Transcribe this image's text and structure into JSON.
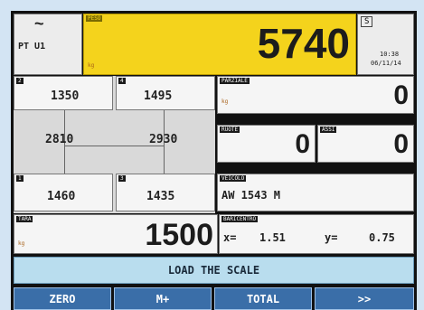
{
  "colors": {
    "accent_yellow": "#f4d31c",
    "banner_blue": "#b9ddee",
    "button_blue": "#3a6ea8"
  },
  "header": {
    "wave_icon": "~",
    "pt_label": "PT U1",
    "main_tag": "PESO",
    "main_value": "5740",
    "main_unit": "kg",
    "s_label": "S",
    "time": "10:38",
    "date": "06/11/14"
  },
  "axles": [
    {
      "index": "2",
      "value": "1350"
    },
    {
      "index": "4",
      "value": "1495"
    },
    {
      "value": "2810"
    },
    {
      "value": "2930"
    },
    {
      "index": "1",
      "value": "1460"
    },
    {
      "index": "3",
      "value": "1435"
    }
  ],
  "partial": {
    "tag": "PARZIALE",
    "unit": "kg",
    "value": "0"
  },
  "wheels": {
    "tag": "RUOTE",
    "value": "0"
  },
  "axles_count": {
    "tag": "ASSI",
    "value": "0"
  },
  "vehicle": {
    "tag": "VEICOLO",
    "value": "AW 1543 M"
  },
  "tare": {
    "tag": "TARA",
    "unit": "kg",
    "value": "1500"
  },
  "gravity": {
    "tag": "BARICENTRO",
    "x_label": "x=",
    "x_value": "1.51",
    "y_label": "y=",
    "y_value": "0.75"
  },
  "banner": "LOAD THE SCALE",
  "buttons": [
    "ZERO",
    "M+",
    "TOTAL",
    ">>"
  ]
}
